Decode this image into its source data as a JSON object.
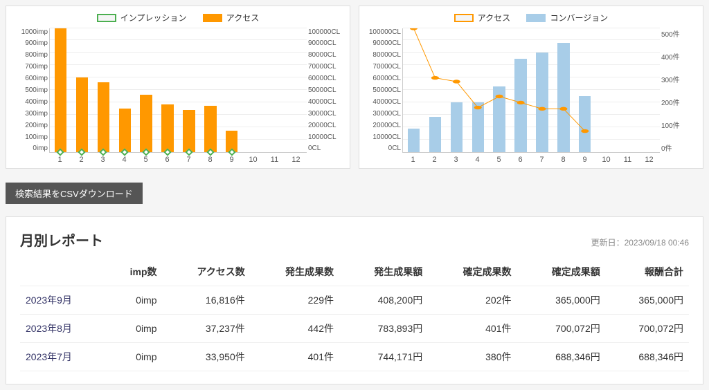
{
  "chart_data": [
    {
      "type": "bar",
      "title": "",
      "legend": [
        "インプレッション",
        "アクセス"
      ],
      "x": [
        1,
        2,
        3,
        4,
        5,
        6,
        7,
        8,
        9,
        10,
        11,
        12
      ],
      "left_axis_label_suffix": "imp",
      "right_axis_label_suffix": "CL",
      "left_ticks": [
        0,
        100,
        200,
        300,
        400,
        500,
        600,
        700,
        800,
        900,
        1000
      ],
      "right_ticks": [
        0,
        10000,
        20000,
        30000,
        40000,
        50000,
        60000,
        70000,
        80000,
        90000,
        100000
      ],
      "series": [
        {
          "name": "インプレッション",
          "axis": "left",
          "type": "line",
          "values": [
            0,
            0,
            0,
            0,
            0,
            0,
            0,
            0,
            0,
            null,
            null,
            null
          ]
        },
        {
          "name": "アクセス",
          "axis": "right",
          "type": "bar",
          "values": [
            100000,
            60000,
            56000,
            35000,
            46000,
            38000,
            34000,
            37000,
            17000,
            null,
            null,
            null
          ]
        }
      ]
    },
    {
      "type": "combo",
      "title": "",
      "legend": [
        "アクセス",
        "コンバージョン"
      ],
      "x": [
        1,
        2,
        3,
        4,
        5,
        6,
        7,
        8,
        9,
        10,
        11,
        12
      ],
      "left_axis_label_suffix": "CL",
      "right_axis_label_suffix": "件",
      "left_ticks": [
        0,
        10000,
        20000,
        30000,
        40000,
        50000,
        60000,
        70000,
        80000,
        90000,
        100000
      ],
      "right_ticks": [
        0,
        100,
        200,
        300,
        400,
        500
      ],
      "series": [
        {
          "name": "コンバージョン",
          "axis": "right",
          "type": "bar",
          "values": [
            95,
            140,
            200,
            200,
            265,
            375,
            400,
            440,
            225,
            null,
            null,
            null
          ]
        },
        {
          "name": "アクセス",
          "axis": "left",
          "type": "line",
          "values": [
            100000,
            60000,
            57000,
            36000,
            45000,
            40000,
            35000,
            35000,
            17000,
            null,
            null,
            null
          ]
        }
      ]
    }
  ],
  "legend1_imp": "インプレッション",
  "legend1_access": "アクセス",
  "legend2_access": "アクセス",
  "legend2_cv": "コンバージョン",
  "csv_button": "検索結果をCSVダウンロード",
  "report_title": "月別レポート",
  "report_date_label": "更新日：",
  "report_date": "2023/09/18 00:46",
  "headers": {
    "period": "",
    "imp": "imp数",
    "access": "アクセス数",
    "hassei_count": "発生成果数",
    "hassei_amount": "発生成果額",
    "kakutei_count": "確定成果数",
    "kakutei_amount": "確定成果額",
    "reward": "報酬合計"
  },
  "rows": [
    {
      "period": "2023年9月",
      "imp": "0imp",
      "access": "16,816件",
      "hc": "229件",
      "ha": "408,200円",
      "kc": "202件",
      "ka": "365,000円",
      "rw": "365,000円"
    },
    {
      "period": "2023年8月",
      "imp": "0imp",
      "access": "37,237件",
      "hc": "442件",
      "ha": "783,893円",
      "kc": "401件",
      "ka": "700,072円",
      "rw": "700,072円"
    },
    {
      "period": "2023年7月",
      "imp": "0imp",
      "access": "33,950件",
      "hc": "401件",
      "ha": "744,171円",
      "kc": "380件",
      "ka": "688,346円",
      "rw": "688,346円"
    }
  ]
}
